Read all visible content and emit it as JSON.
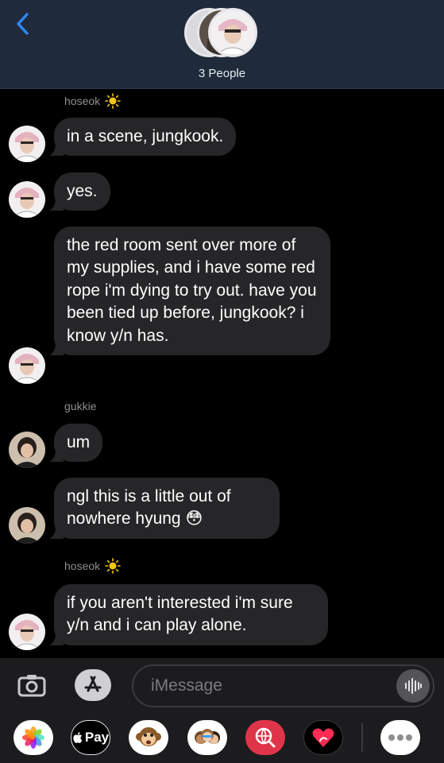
{
  "header": {
    "people_count": "3 People"
  },
  "messages": [
    {
      "sender": "hoseok",
      "text": "in a scene, jungkook."
    },
    {
      "text": "yes."
    },
    {
      "text": "the red room sent over more of my supplies, and i have some red rope i'm dying to try out. have you been tied up before, jungkook? i know y/n has."
    },
    {
      "sender": "gukkie",
      "text": "um"
    },
    {
      "text": "ngl this is a little out of nowhere hyung 😳"
    },
    {
      "sender": "hoseok",
      "text": "if you aren't interested i'm sure y/n and i can play alone."
    }
  ],
  "compose": {
    "placeholder": "iMessage"
  },
  "apps": {
    "applepay_label": "Pay"
  },
  "colors": {
    "header_bg": "#1f2a3a",
    "bubble_bg": "#262628",
    "link_blue": "#2f86ff"
  }
}
